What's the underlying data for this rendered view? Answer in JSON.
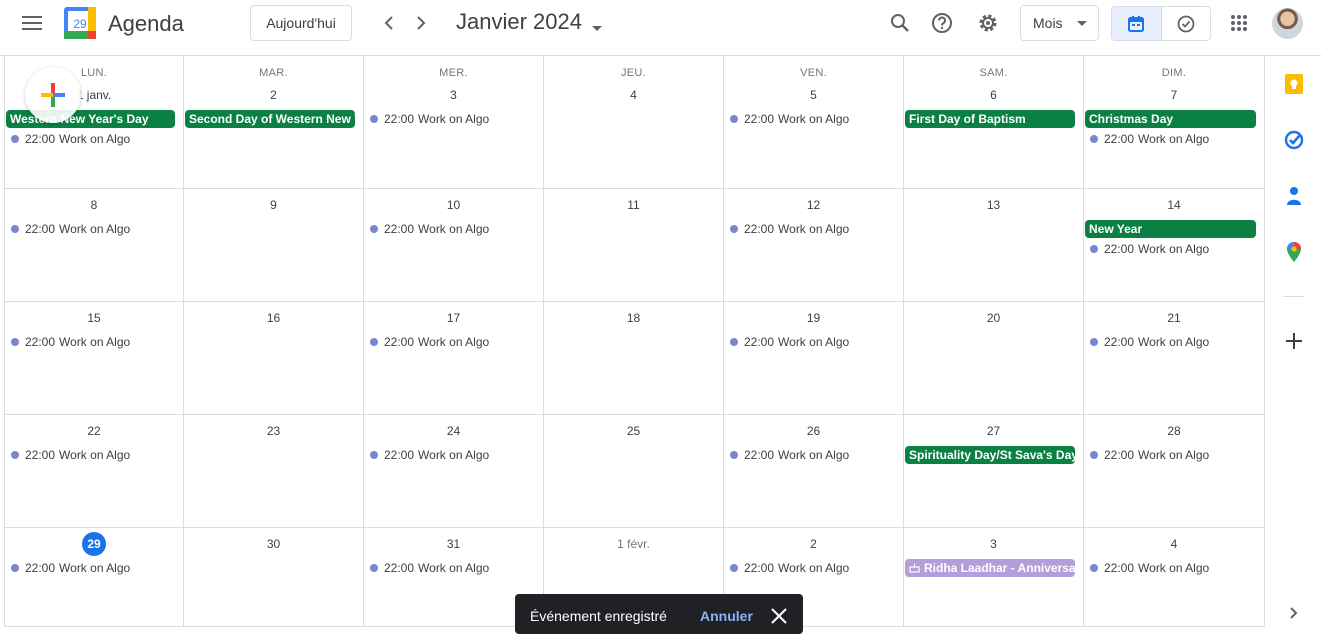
{
  "app": {
    "name": "Agenda",
    "logo_day": "29"
  },
  "toolbar": {
    "today_label": "Aujourd'hui",
    "period_title": "Janvier 2024",
    "view_label": "Mois"
  },
  "weekdays": [
    "LUN.",
    "MAR.",
    "MER.",
    "JEU.",
    "VEN.",
    "SAM.",
    "DIM."
  ],
  "weeks": [
    [
      {
        "label": "1 janv.",
        "holiday": "Western New Year's Day",
        "event": {
          "time": "22:00",
          "title": "Work on Algo"
        }
      },
      {
        "label": "2",
        "holiday": "Second Day of Western New Y"
      },
      {
        "label": "3",
        "event": {
          "time": "22:00",
          "title": "Work on Algo"
        }
      },
      {
        "label": "4"
      },
      {
        "label": "5",
        "event": {
          "time": "22:00",
          "title": "Work on Algo"
        }
      },
      {
        "label": "6",
        "holiday": "First Day of Baptism"
      },
      {
        "label": "7",
        "holiday": "Christmas Day",
        "event": {
          "time": "22:00",
          "title": "Work on Algo"
        }
      }
    ],
    [
      {
        "label": "8",
        "event": {
          "time": "22:00",
          "title": "Work on Algo"
        }
      },
      {
        "label": "9"
      },
      {
        "label": "10",
        "event": {
          "time": "22:00",
          "title": "Work on Algo"
        }
      },
      {
        "label": "11"
      },
      {
        "label": "12",
        "event": {
          "time": "22:00",
          "title": "Work on Algo"
        }
      },
      {
        "label": "13"
      },
      {
        "label": "14",
        "holiday": "New Year",
        "event": {
          "time": "22:00",
          "title": "Work on Algo"
        }
      }
    ],
    [
      {
        "label": "15",
        "event": {
          "time": "22:00",
          "title": "Work on Algo"
        }
      },
      {
        "label": "16"
      },
      {
        "label": "17",
        "event": {
          "time": "22:00",
          "title": "Work on Algo"
        }
      },
      {
        "label": "18"
      },
      {
        "label": "19",
        "event": {
          "time": "22:00",
          "title": "Work on Algo"
        }
      },
      {
        "label": "20"
      },
      {
        "label": "21",
        "event": {
          "time": "22:00",
          "title": "Work on Algo"
        }
      }
    ],
    [
      {
        "label": "22",
        "event": {
          "time": "22:00",
          "title": "Work on Algo"
        }
      },
      {
        "label": "23"
      },
      {
        "label": "24",
        "event": {
          "time": "22:00",
          "title": "Work on Algo"
        }
      },
      {
        "label": "25"
      },
      {
        "label": "26",
        "event": {
          "time": "22:00",
          "title": "Work on Algo"
        }
      },
      {
        "label": "27",
        "holiday": "Spirituality Day/St Sava's Day"
      },
      {
        "label": "28",
        "event": {
          "time": "22:00",
          "title": "Work on Algo"
        }
      }
    ],
    [
      {
        "label": "29",
        "today": true,
        "event": {
          "time": "22:00",
          "title": "Work on Algo"
        }
      },
      {
        "label": "30"
      },
      {
        "label": "31",
        "event": {
          "time": "22:00",
          "title": "Work on Algo"
        }
      },
      {
        "label": "1 févr.",
        "other_month": true
      },
      {
        "label": "2",
        "other_month": true,
        "event": {
          "time": "22:00",
          "title": "Work on Algo"
        }
      },
      {
        "label": "3",
        "other_month": true,
        "anniversary": "Ridha Laadhar - Anniversaire"
      },
      {
        "label": "4",
        "other_month": true,
        "event": {
          "time": "22:00",
          "title": "Work on Algo"
        }
      }
    ]
  ],
  "toast": {
    "message": "Événement enregistré",
    "undo_label": "Annuler"
  },
  "colors": {
    "holiday": "#0b8043",
    "event_dot": "#7986cb",
    "today": "#1a73e8",
    "anniversary": "#b39ddb",
    "accent": "#1a73e8"
  }
}
